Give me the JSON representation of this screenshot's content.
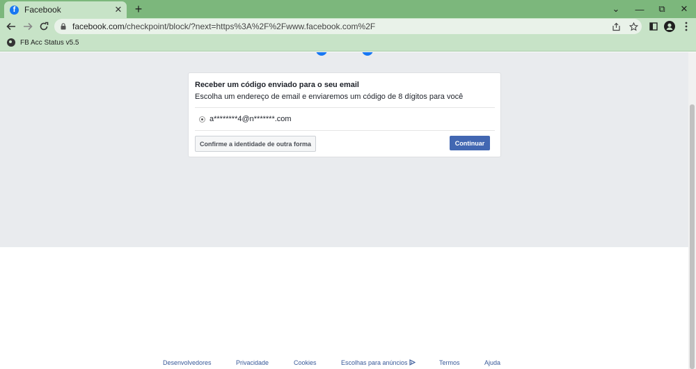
{
  "browser": {
    "tab": {
      "title": "Facebook",
      "favicon_letter": "f",
      "close_glyph": "✕"
    },
    "new_tab_glyph": "+",
    "window_controls": {
      "dropdown": "⌄",
      "minimize": "—",
      "restore": "⧉",
      "close": "✕"
    },
    "url": {
      "domain": "facebook.com",
      "path": "/checkpoint/block/?next=https%3A%2F%2Fwww.facebook.com%2F"
    },
    "bookmark": {
      "label": "FB Acc Status v5.5"
    },
    "icons": [
      "back-icon",
      "forward-icon",
      "reload-icon",
      "lock-icon",
      "share-icon",
      "star-icon",
      "side-panel-icon",
      "profile-icon",
      "menu-icon"
    ]
  },
  "card": {
    "title": "Receber um código enviado para o seu email",
    "description": "Escolha um endereço de email e enviaremos um código de 8 dígitos para você",
    "email_option": "a********4@n*******.com",
    "alt_button": "Confirme a identidade de outra forma",
    "continue_button": "Continuar"
  },
  "footer": {
    "links": [
      "Desenvolvedores",
      "Privacidade",
      "Cookies",
      "Escolhas para anúncios",
      "Termos",
      "Ajuda"
    ]
  },
  "colors": {
    "tabstrip": "#7cb77c",
    "toolbar": "#c7e3c7",
    "page_gray": "#e9ebee",
    "primary_button": "#4267b2",
    "footer_link": "#385898"
  }
}
